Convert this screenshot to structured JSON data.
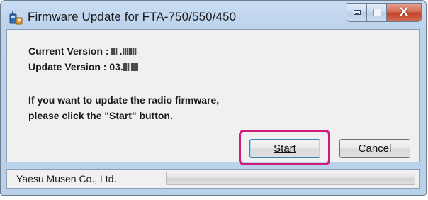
{
  "window": {
    "title": "Firmware Update for FTA-750/550/450",
    "icons": {
      "app": "radio-app-icon",
      "minimize": "minimize-icon",
      "maximize": "maximize-icon",
      "close": "close-icon"
    },
    "close_glyph": "X"
  },
  "dialog": {
    "current_version_label": "Current Version :",
    "update_version_label": "Update Version :",
    "update_version_prefix": "03.",
    "message_line1": "If you want to update the radio firmware,",
    "message_line2": "please click the \"Start\" button."
  },
  "buttons": {
    "start_label": "Start",
    "cancel_label": "Cancel"
  },
  "status": {
    "company": "Yaesu Musen Co., Ltd.",
    "progress": 0
  },
  "colors": {
    "highlight": "#d21a7a",
    "progress_fill": "#06b025",
    "close_button": "#c1452a"
  }
}
